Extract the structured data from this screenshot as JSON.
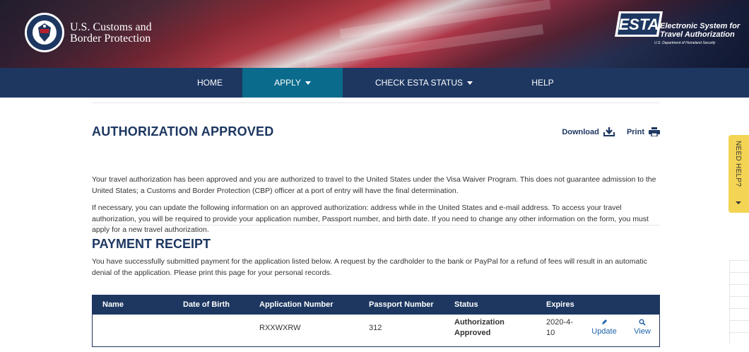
{
  "header": {
    "agency_line1": "U.S. Customs and",
    "agency_line2": "Border Protection",
    "seal_text": "DEPARTMENT OF HOMELAND SECURITY",
    "esta_logo_text": "ESTA",
    "esta_sub1": "Electronic System for",
    "esta_sub2": "Travel Authorization",
    "esta_sub3": "U.S. Department of Homeland Security"
  },
  "nav": {
    "items": [
      {
        "label": "HOME"
      },
      {
        "label": "APPLY"
      },
      {
        "label": "CHECK ESTA STATUS"
      },
      {
        "label": "HELP"
      }
    ],
    "active": "APPLY"
  },
  "main": {
    "title": "AUTHORIZATION APPROVED",
    "download_label": "Download",
    "print_label": "Print",
    "para1": "Your travel authorization has been approved and you are authorized to travel to the United States under the Visa Waiver Program. This does not guarantee admission to the United States; a Customs and Border Protection (CBP) officer at a port of entry will have the final determination.",
    "para2": "If necessary, you can update the following information on an approved authorization: address while in the United States and e-mail address. To access your travel authorization, you will be required to provide your application number, Passport number, and birth date. If you need to change any other information on the form, you must apply for a new travel authorization."
  },
  "receipt": {
    "title": "PAYMENT RECEIPT",
    "para": "You have successfully submitted payment for the application listed below. A request by the cardholder to the bank or PayPal for a refund of fees will result in an automatic denial of the application. Please print this page for your personal records.",
    "columns": [
      "Name",
      "Date of Birth",
      "Application Number",
      "Passport Number",
      "Status",
      "Expires"
    ],
    "rows": [
      {
        "name": "",
        "dob": "",
        "application_number": "RXXWXRW",
        "passport_number": "312",
        "status_line1": "Authorization",
        "status_line2": "Approved",
        "expires_line1": "2020-4-",
        "expires_line2": "10",
        "update_label": "Update",
        "view_label": "View"
      }
    ]
  },
  "side_tab": {
    "label": "NEED HELP?"
  },
  "colors": {
    "navy": "#1d3761",
    "nav_active": "#0b6b8c",
    "link": "#1f63a8",
    "help_tab": "#f3d454"
  }
}
